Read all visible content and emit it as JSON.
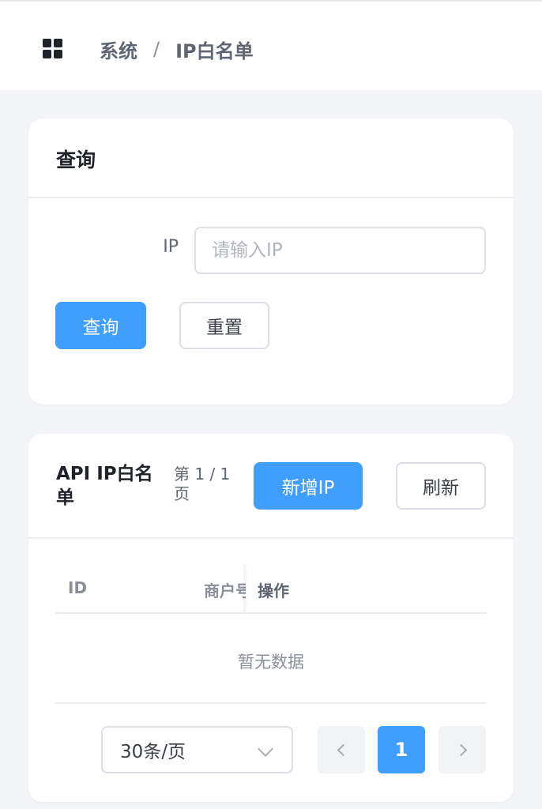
{
  "breadcrumb": {
    "root": "系统",
    "separator": "/",
    "current": "IP白名单"
  },
  "query_card": {
    "title": "查询",
    "ip_label": "IP",
    "ip_placeholder": "请输入IP",
    "ip_value": "",
    "query_button": "查询",
    "reset_button": "重置"
  },
  "list_card": {
    "title": "API IP白名单",
    "page_info": "第 1 / 1 页",
    "add_button": "新增IP",
    "refresh_button": "刷新",
    "columns": [
      "ID",
      "商户号",
      "操作"
    ],
    "rows": [],
    "empty_text": "暂无数据"
  },
  "pagination": {
    "page_size": "30条/页",
    "current_page": "1"
  },
  "colors": {
    "primary": "#409eff",
    "background": "#f4f5f8"
  },
  "icons": {
    "menu": "grid-icon",
    "select": "chevron-down-icon",
    "prev": "chevron-left-icon",
    "next": "chevron-right-icon"
  }
}
